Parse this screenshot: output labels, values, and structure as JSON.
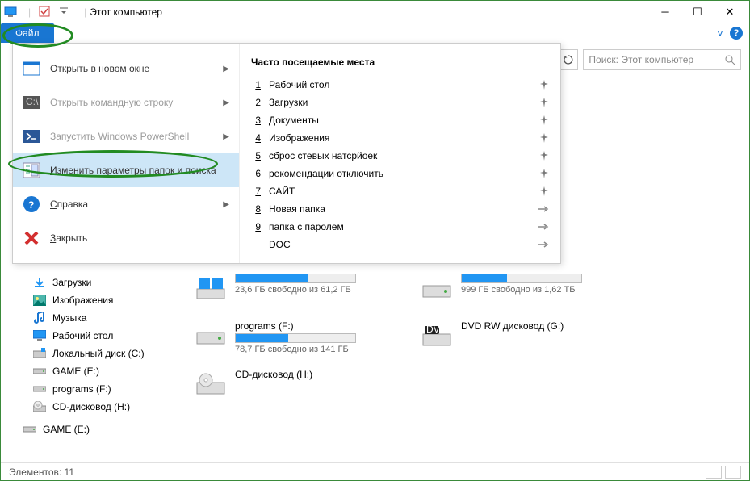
{
  "title": "Этот компьютер",
  "file_tab": "Файл",
  "ribbon": {
    "expand": "˅"
  },
  "search": {
    "placeholder": "Поиск: Этот компьютер"
  },
  "file_menu": {
    "open_new": "Открыть в новом окне",
    "open_cmd": "Открыть командную строку",
    "run_ps": "Запустить Windows PowerShell",
    "change_params": "Изменить параметры папок и поиска",
    "help": "Справка",
    "close": "Закрыть"
  },
  "recent": {
    "title": "Часто посещаемые места",
    "items": [
      {
        "n": "1",
        "label": "Рабочий стол",
        "pinned": true
      },
      {
        "n": "2",
        "label": "Загрузки",
        "pinned": true
      },
      {
        "n": "3",
        "label": "Документы",
        "pinned": true
      },
      {
        "n": "4",
        "label": "Изображения",
        "pinned": true
      },
      {
        "n": "5",
        "label": "сброс стевых натсрйоек",
        "pinned": true
      },
      {
        "n": "6",
        "label": "рекомендации отключить",
        "pinned": true
      },
      {
        "n": "7",
        "label": "САЙТ",
        "pinned": true
      },
      {
        "n": "8",
        "label": "Новая папка",
        "pinned": false
      },
      {
        "n": "9",
        "label": "папка с паролем",
        "pinned": false
      },
      {
        "n": "",
        "label": "DOC",
        "pinned": false
      }
    ]
  },
  "sidebar": {
    "items": [
      {
        "label": "Загрузки",
        "icon": "downloads"
      },
      {
        "label": "Изображения",
        "icon": "pictures"
      },
      {
        "label": "Музыка",
        "icon": "music"
      },
      {
        "label": "Рабочий стол",
        "icon": "desktop"
      },
      {
        "label": "Локальный диск (C:)",
        "icon": "disk"
      },
      {
        "label": "GAME (E:)",
        "icon": "drive"
      },
      {
        "label": "programs (F:)",
        "icon": "drive"
      },
      {
        "label": "CD-дисковод (H:)",
        "icon": "cd"
      }
    ],
    "group": "GAME (E:)"
  },
  "drives": {
    "row1": [
      {
        "title": "",
        "sub": "23,6 ГБ свободно из 61,2 ГБ",
        "fill": 61
      },
      {
        "title": "",
        "sub": "999 ГБ свободно из 1,62 ТБ",
        "fill": 38
      }
    ],
    "row2a": {
      "title": "programs (F:)",
      "sub": "78,7 ГБ свободно из 141 ГБ",
      "fill": 44
    },
    "row2b": {
      "title": "DVD RW дисковод (G:)"
    },
    "row3": {
      "title": "CD-дисковод (H:)"
    }
  },
  "status": {
    "label": "Элементов: 11"
  }
}
